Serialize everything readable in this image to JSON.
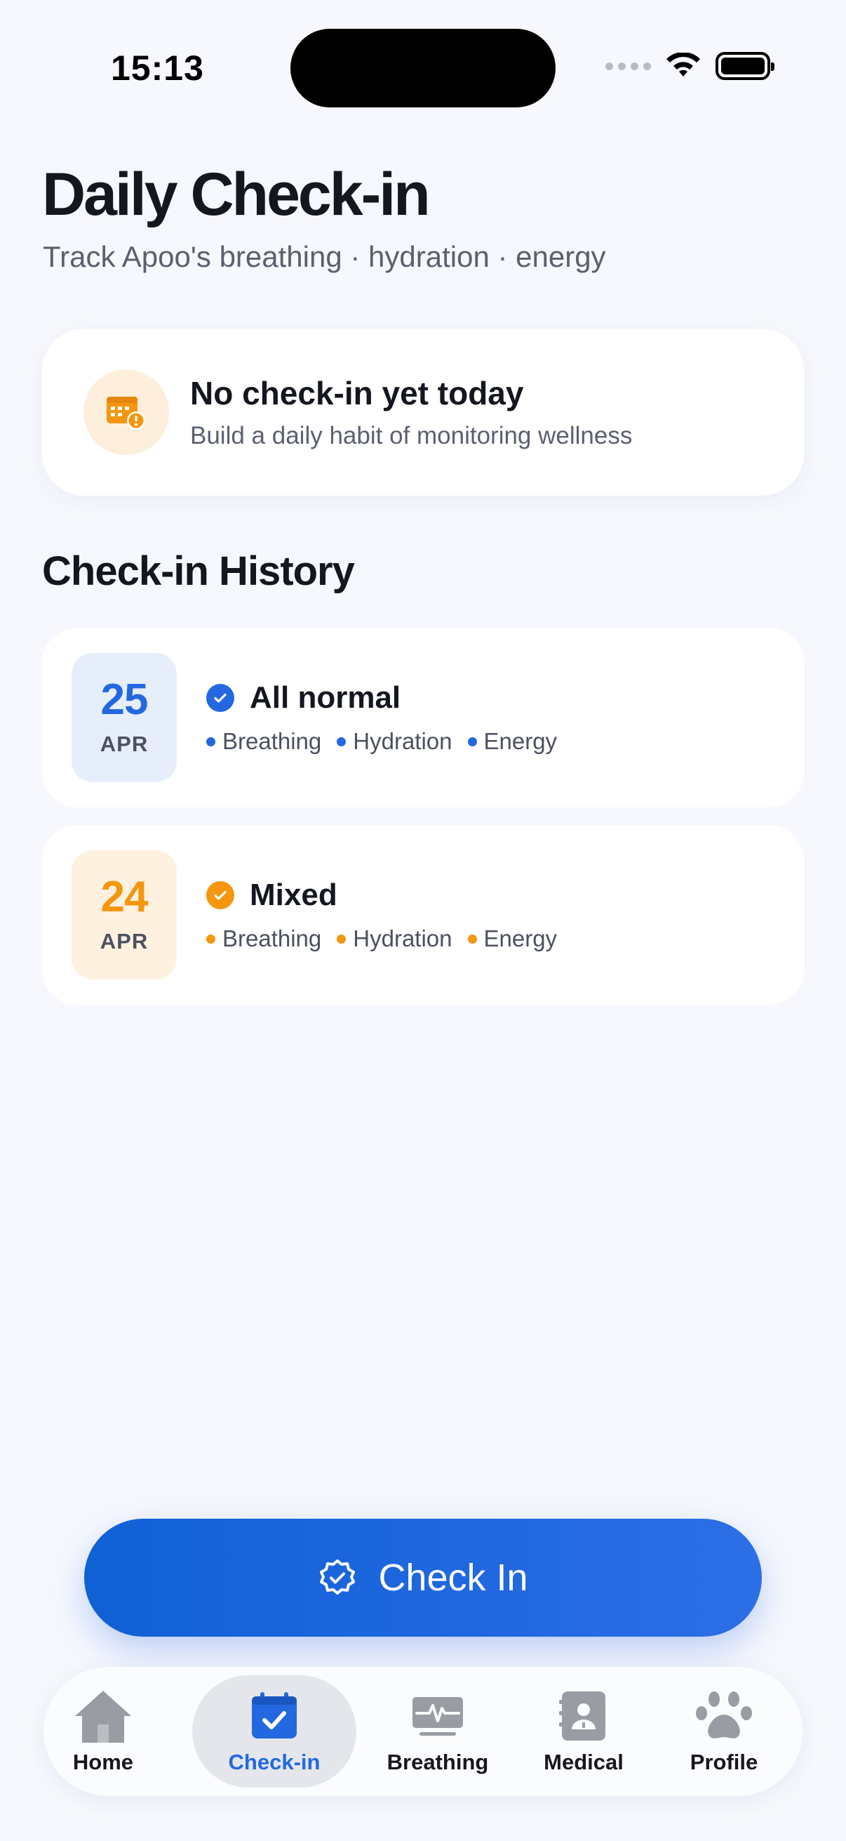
{
  "status_bar": {
    "time": "15:13"
  },
  "header": {
    "title": "Daily Check-in",
    "subtitle": "Track Apoo's breathing · hydration · energy"
  },
  "notice": {
    "icon": "calendar-alert-icon",
    "title": "No check-in yet today",
    "description": "Build a daily habit of monitoring wellness"
  },
  "history": {
    "title": "Check-in History",
    "items": [
      {
        "day": "25",
        "month": "APR",
        "status": "All normal",
        "color": "#2368e0",
        "metrics": [
          "Breathing",
          "Hydration",
          "Energy"
        ]
      },
      {
        "day": "24",
        "month": "APR",
        "status": "Mixed",
        "color": "#f4960e",
        "metrics": [
          "Breathing",
          "Hydration",
          "Energy"
        ]
      }
    ]
  },
  "checkin_button": {
    "label": "Check In",
    "icon": "badge-check-icon"
  },
  "tabs": [
    {
      "label": "Home",
      "icon": "house-icon",
      "active": false
    },
    {
      "label": "Check-in",
      "icon": "calendar-check-icon",
      "active": true
    },
    {
      "label": "Breathing",
      "icon": "monitor-waveform-icon",
      "active": false
    },
    {
      "label": "Medical",
      "icon": "medical-record-icon",
      "active": false
    },
    {
      "label": "Profile",
      "icon": "paw-icon",
      "active": false
    }
  ],
  "colors": {
    "accent": "#2368e0",
    "warning": "#f4960e",
    "background": "#f6f8fd"
  }
}
